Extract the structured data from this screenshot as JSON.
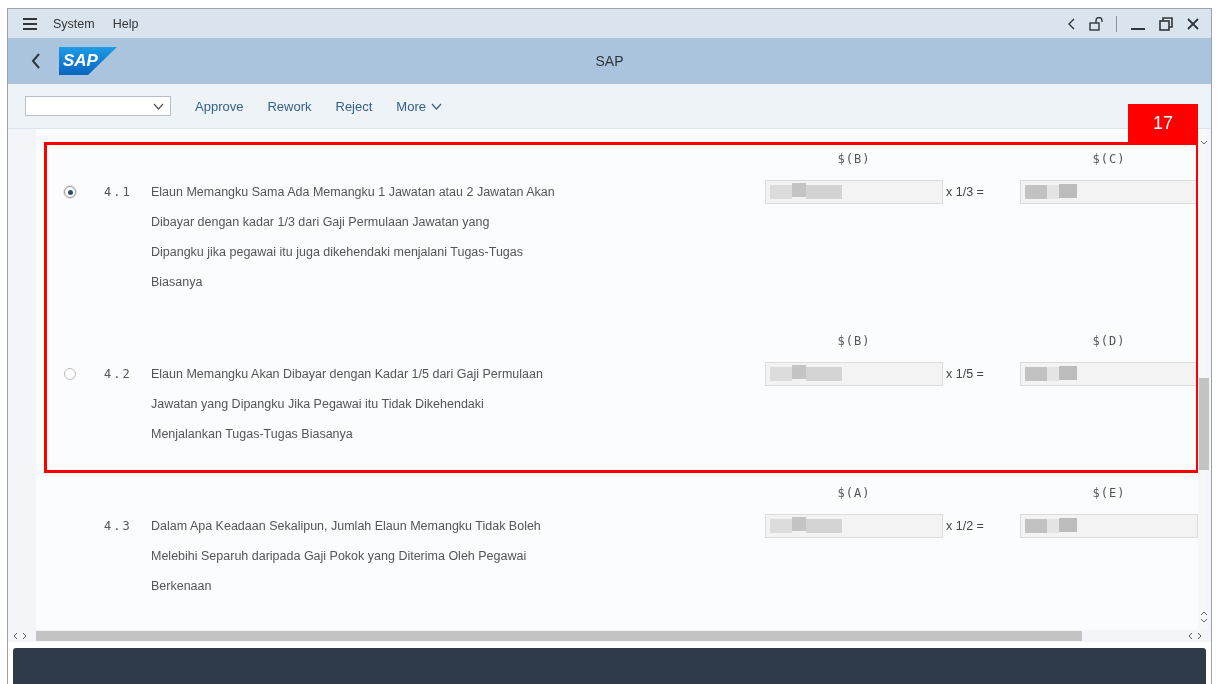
{
  "menu_bar": {
    "items": [
      "System",
      "Help"
    ]
  },
  "title_bar": {
    "logo": "SAP",
    "title": "SAP"
  },
  "toolbar": {
    "buttons": [
      "Approve",
      "Rework",
      "Reject",
      "More"
    ]
  },
  "callout": {
    "label": "17"
  },
  "items": [
    {
      "kind": "radio",
      "selected": true,
      "number": "4.1",
      "lines": [
        "Elaun Memangku Sama Ada Memangku 1 Jawatan atau 2 Jawatan Akan",
        "Dibayar dengan kadar 1/3 dari Gaji Permulaan Jawatan yang",
        "Dipangku jika pegawai itu juga dikehendaki menjalani Tugas-Tugas",
        "Biasanya"
      ],
      "left_header": "$(B)",
      "multiplier": "x 1/3 =",
      "right_header": "$(C)"
    },
    {
      "kind": "radio",
      "selected": false,
      "number": "4.2",
      "lines": [
        "Elaun Memangku Akan Dibayar dengan Kadar 1/5 dari Gaji Permulaan",
        "Jawatan yang Dipangku Jika Pegawai itu Tidak Dikehendaki",
        "Menjalankan Tugas-Tugas Biasanya"
      ],
      "left_header": "$(B)",
      "multiplier": "x 1/5 =",
      "right_header": "$(D)"
    },
    {
      "kind": "plain",
      "number": "4.3",
      "lines": [
        "Dalam Apa Keadaan Sekalipun, Jumlah Elaun Memangku Tidak Boleh",
        "Melebihi Separuh daripada Gaji Pokok yang Diterima Oleh Pegawai",
        "Berkenaan"
      ],
      "left_header": "$(A)",
      "multiplier": "x 1/2 =",
      "right_header": "$(E)"
    }
  ]
}
